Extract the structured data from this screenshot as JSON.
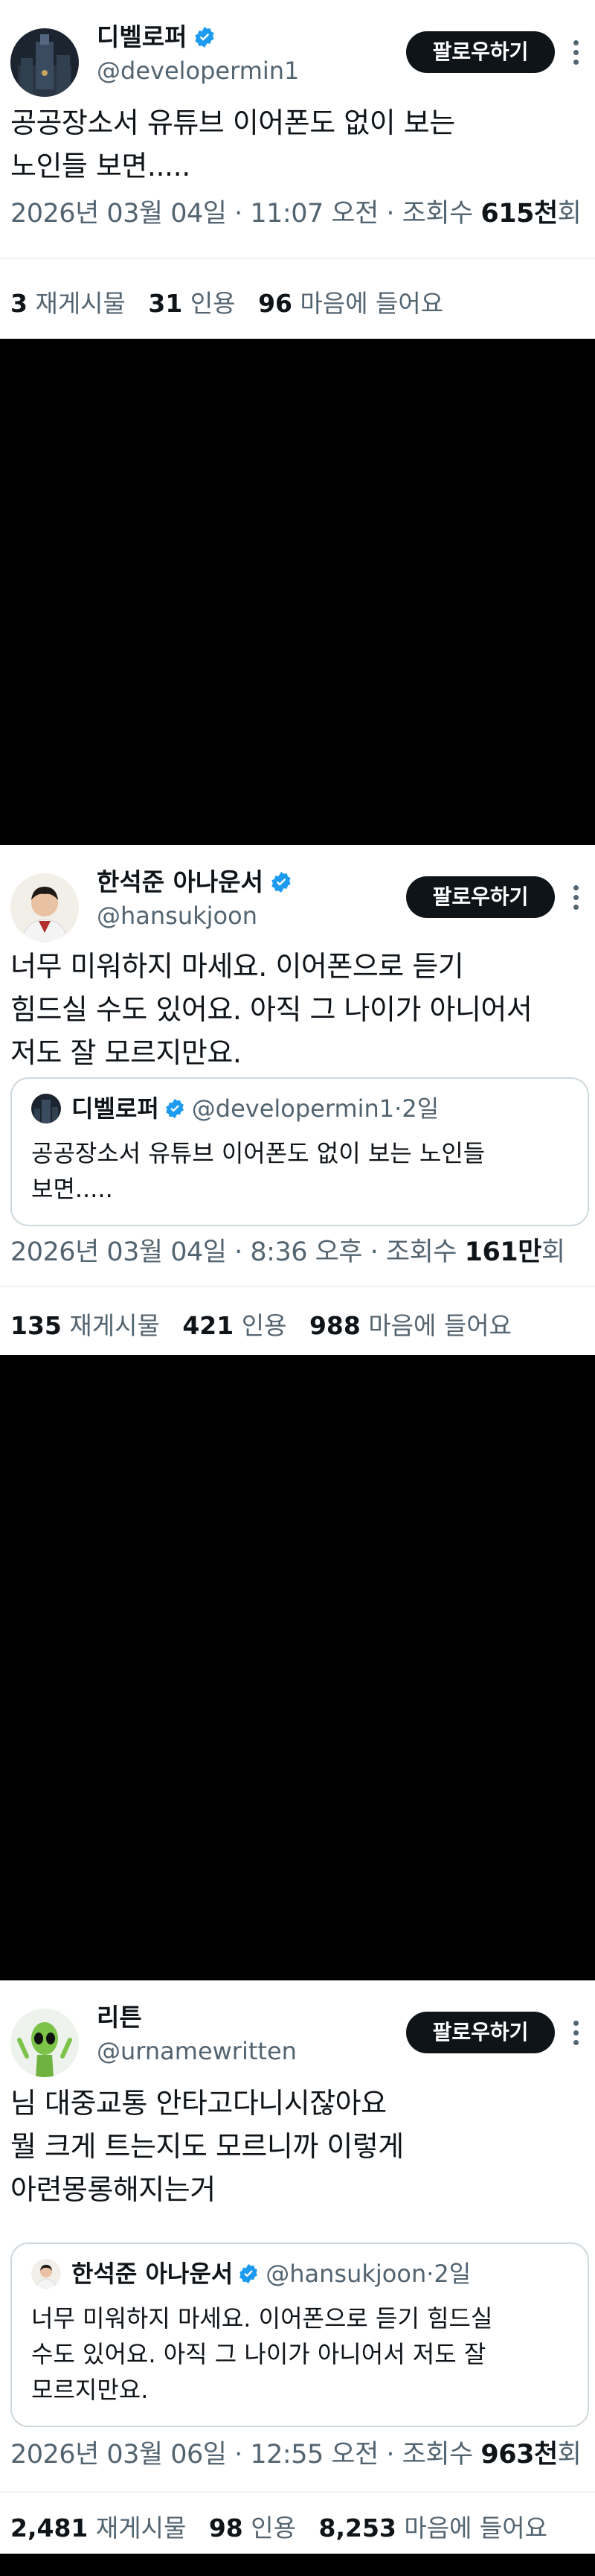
{
  "tweets": [
    {
      "author": {
        "name": "디벨로퍼",
        "handle": "@developermin1"
      },
      "follow_label": "팔로우하기",
      "text_lines": [
        "공공장소서 유튜브 이어폰도 없이 보는",
        "노인들 보면....."
      ],
      "meta": {
        "date": "2026년 03월 04일",
        "sep": " · ",
        "time": "11:07 오전",
        "views_label": "조회수 ",
        "views_num": "615천",
        "views_unit": "회"
      },
      "stats": {
        "reposts": "3",
        "reposts_label": " 재게시물",
        "quotes": "31",
        "quotes_label": " 인용",
        "likes": "96",
        "likes_label": " 마음에 들어요"
      }
    },
    {
      "author": {
        "name": "한석준 아나운서",
        "handle": "@hansukjoon"
      },
      "follow_label": "팔로우하기",
      "text_lines": [
        "너무 미워하지 마세요. 이어폰으로 듣기",
        "힘드실 수도 있어요. 아직 그 나이가 아니어서",
        "저도 잘 모르지만요."
      ],
      "quote": {
        "name": "디벨로퍼",
        "handle": "@developermin1",
        "dot": "·",
        "time": "2일",
        "text_lines": [
          "공공장소서 유튜브 이어폰도 없이 보는 노인들",
          "보면....."
        ]
      },
      "meta": {
        "date": "2026년 03월 04일",
        "sep": " · ",
        "time": "8:36 오후",
        "views_label": "조회수 ",
        "views_num": "161만",
        "views_unit": "회"
      },
      "stats": {
        "reposts": "135",
        "reposts_label": " 재게시물",
        "quotes": "421",
        "quotes_label": " 인용",
        "likes": "988",
        "likes_label": " 마음에 들어요"
      }
    },
    {
      "author": {
        "name": "리튼",
        "handle": "@urnamewritten"
      },
      "follow_label": "팔로우하기",
      "text_lines": [
        "님 대중교통 안타고다니시잖아요",
        "뭘 크게 트는지도 모르니까 이렇게",
        "아련몽롱해지는거"
      ],
      "quote": {
        "name": "한석준 아나운서",
        "handle": "@hansukjoon",
        "dot": "·",
        "time": "2일",
        "text_lines": [
          "너무 미워하지 마세요. 이어폰으로 듣기 힘드실",
          "수도 있어요. 아직 그 나이가 아니어서 저도 잘",
          "모르지만요."
        ]
      },
      "meta": {
        "date": "2026년 03월 06일",
        "sep": " · ",
        "time": "12:55 오전",
        "views_label": "조회수 ",
        "views_num": "963천",
        "views_unit": "회"
      },
      "stats": {
        "reposts": "2,481",
        "reposts_label": " 재게시물",
        "quotes": "98",
        "quotes_label": " 인용",
        "likes": "8,253",
        "likes_label": " 마음에 들어요"
      }
    }
  ],
  "colors": {
    "verified": "#1d9bf0",
    "follow_bg": "#0f1419",
    "muted": "#536471",
    "background": "#000000"
  },
  "icons": {
    "verified": "verified-badge-icon",
    "more": "more-options-icon"
  }
}
